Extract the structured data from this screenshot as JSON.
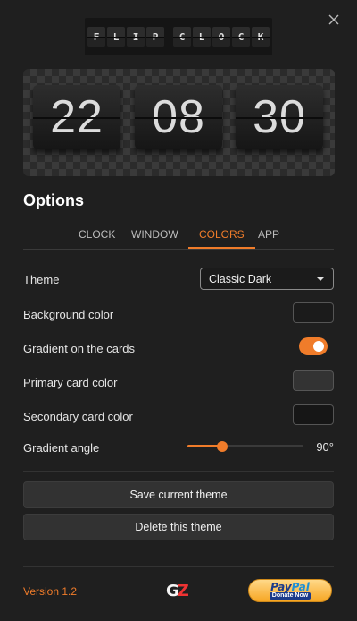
{
  "header": {
    "logo_word_1": [
      "F",
      "L",
      "I",
      "P"
    ],
    "logo_word_2": [
      "C",
      "L",
      "O",
      "C",
      "K"
    ]
  },
  "preview": {
    "hours": "22",
    "minutes": "08",
    "seconds": "30"
  },
  "options": {
    "title": "Options",
    "tabs": [
      {
        "label": "CLOCK",
        "active": false
      },
      {
        "label": "WINDOW",
        "active": false
      },
      {
        "label": "COLORS",
        "active": true
      },
      {
        "label": "APP",
        "active": false
      }
    ]
  },
  "colors": {
    "theme_label": "Theme",
    "theme_value": "Classic Dark",
    "background_color_label": "Background color",
    "background_color_value": "#1b1b1b",
    "gradient_label": "Gradient on the cards",
    "gradient_enabled": true,
    "primary_card_color_label": "Primary card color",
    "primary_card_color_value": "#333333",
    "secondary_card_color_label": "Secondary card color",
    "secondary_card_color_value": "#161616",
    "gradient_angle_label": "Gradient angle",
    "gradient_angle_value": "90°",
    "gradient_angle_fraction": 0.28
  },
  "actions": {
    "save_label": "Save current theme",
    "delete_label": "Delete this theme"
  },
  "footer": {
    "version": "Version 1.2",
    "paypal_brand_1": "Pay",
    "paypal_brand_2": "Pal",
    "paypal_sub": "Donate Now"
  },
  "accent_color": "#f07c2a"
}
